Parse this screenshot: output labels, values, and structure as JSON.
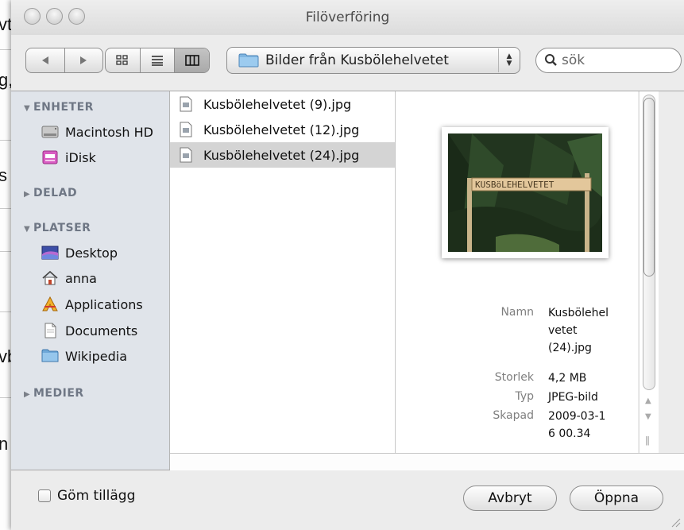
{
  "background_window": {
    "fragments": [
      "vt",
      "g,",
      "s",
      "vb",
      "n"
    ]
  },
  "dialog": {
    "title": "Filöverföring",
    "toolbar": {
      "back_icon": "triangle-left-icon",
      "forward_icon": "triangle-right-icon",
      "view_icons": [
        "icon-view-icon",
        "list-view-icon",
        "column-view-icon"
      ],
      "active_view": "column-view-icon",
      "path_label": "Bilder från Kusbölehelvetet",
      "search_placeholder": "sök"
    },
    "sidebar": {
      "sections": [
        {
          "label": "ENHETER",
          "expanded": true,
          "items": [
            {
              "label": "Macintosh HD",
              "icon": "hard-drive-icon"
            },
            {
              "label": "iDisk",
              "icon": "idisk-icon"
            }
          ]
        },
        {
          "label": "DELAD",
          "expanded": false,
          "items": []
        },
        {
          "label": "PLATSER",
          "expanded": true,
          "items": [
            {
              "label": "Desktop",
              "icon": "desktop-icon"
            },
            {
              "label": "anna",
              "icon": "home-icon"
            },
            {
              "label": "Applications",
              "icon": "applications-icon"
            },
            {
              "label": "Documents",
              "icon": "documents-icon"
            },
            {
              "label": "Wikipedia",
              "icon": "folder-icon"
            }
          ]
        },
        {
          "label": "MEDIER",
          "expanded": false,
          "items": []
        }
      ]
    },
    "files": [
      {
        "name": "Kusbölehelvetet (9).jpg",
        "selected": false
      },
      {
        "name": "Kusbölehelvetet (12).jpg",
        "selected": false
      },
      {
        "name": "Kusbölehelvetet (24).jpg",
        "selected": true
      }
    ],
    "preview": {
      "sign_text": "KUSBöLEHELVETET",
      "meta": [
        {
          "label": "Namn",
          "lines": [
            "Kusbölehel",
            "vetet",
            "(24).jpg"
          ]
        },
        {
          "label": "Storlek",
          "lines": [
            "4,2 MB"
          ]
        },
        {
          "label": "Typ",
          "lines": [
            "JPEG-bild"
          ]
        },
        {
          "label": "Skapad",
          "lines": [
            "2009-03-1",
            "6 00.34"
          ]
        }
      ]
    },
    "hide_extension_label": "Göm tillägg",
    "hide_extension_checked": false,
    "cancel_label": "Avbryt",
    "open_label": "Öppna"
  }
}
